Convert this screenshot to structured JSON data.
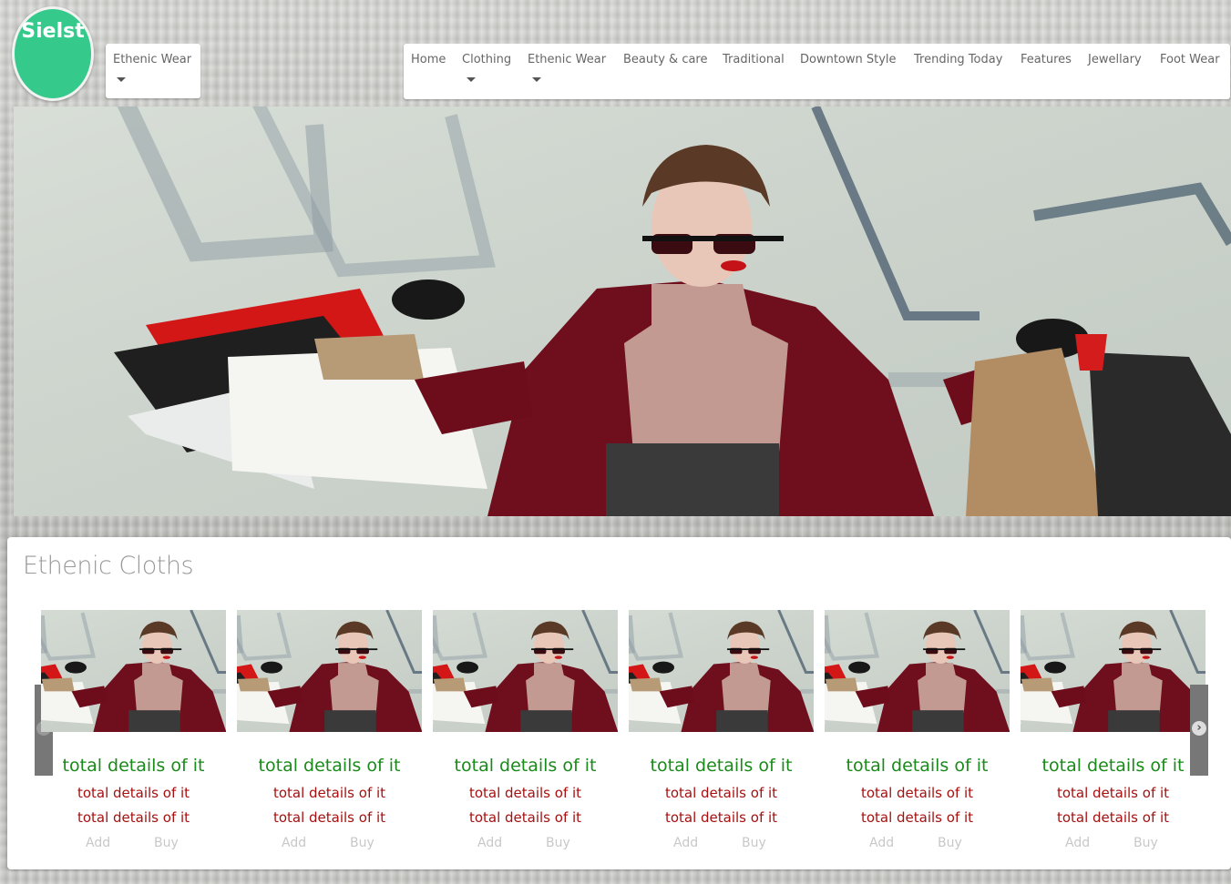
{
  "brand": {
    "logo_text": "Sielst",
    "logo_color": "#35c98b"
  },
  "left_dropdown": {
    "label": "Ethenic Wear"
  },
  "nav": {
    "items": [
      {
        "label": "Home",
        "has_dropdown": false
      },
      {
        "label": "Clothing",
        "has_dropdown": true
      },
      {
        "label": "Ethenic Wear",
        "has_dropdown": true
      },
      {
        "label": "Beauty & care",
        "has_dropdown": false
      },
      {
        "label": "Traditional",
        "has_dropdown": false
      },
      {
        "label": "Downtown Style",
        "has_dropdown": false
      },
      {
        "label": "Trending Today",
        "has_dropdown": false
      },
      {
        "label": "Features",
        "has_dropdown": false
      },
      {
        "label": "Jewellary",
        "has_dropdown": false
      },
      {
        "label": "Foot Wear",
        "has_dropdown": false
      }
    ]
  },
  "hero": {
    "image": "woman-with-shopping-bags-photo"
  },
  "section": {
    "title": "Ethenic Cloths",
    "prev_icon": "chevron-left-icon",
    "next_icon": "chevron-right-icon",
    "products": [
      {
        "title": "total details of it",
        "line1": "total details of it",
        "line2": "total details of it",
        "add": "Add",
        "buy": "Buy"
      },
      {
        "title": "total details of it",
        "line1": "total details of it",
        "line2": "total details of it",
        "add": "Add",
        "buy": "Buy"
      },
      {
        "title": "total details of it",
        "line1": "total details of it",
        "line2": "total details of it",
        "add": "Add",
        "buy": "Buy"
      },
      {
        "title": "total details of it",
        "line1": "total details of it",
        "line2": "total details of it",
        "add": "Add",
        "buy": "Buy"
      },
      {
        "title": "total details of it",
        "line1": "total details of it",
        "line2": "total details of it",
        "add": "Add",
        "buy": "Buy"
      },
      {
        "title": "total details of it",
        "line1": "total details of it",
        "line2": "total details of it",
        "add": "Add",
        "buy": "Buy"
      }
    ]
  },
  "colors": {
    "title_green": "#1a8a1a",
    "detail_red": "#a61010",
    "action_gray": "#c8c8c8"
  }
}
